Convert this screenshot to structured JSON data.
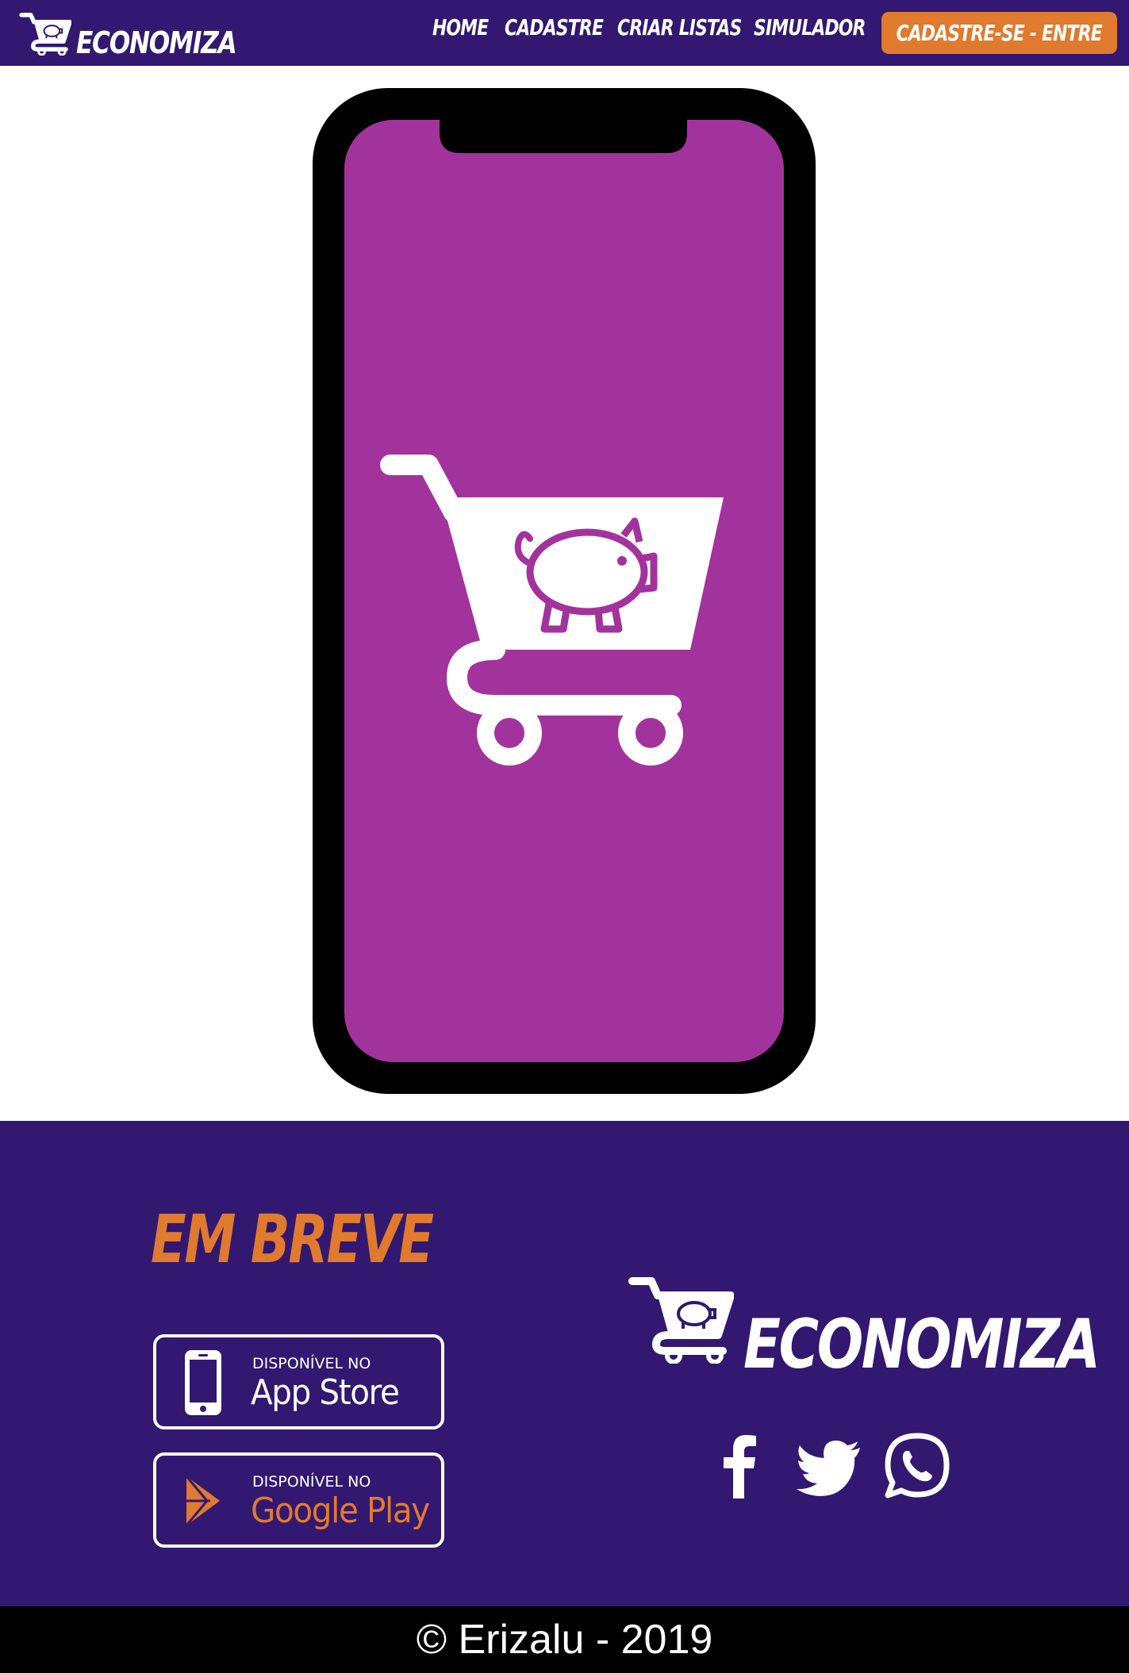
{
  "navbar": {
    "brand": "ECONOMIZA",
    "links": [
      "HOME",
      "CADASTRE",
      "CRIAR LISTAS",
      "SIMULADOR"
    ],
    "cta": "CADASTRE-SE - ENTRE"
  },
  "hero": {
    "image_icon": "shopping-cart-piggy-bank-icon"
  },
  "footer": {
    "coming_soon": "EM BREVE",
    "app_store": {
      "small": "DISPONÍVEL NO",
      "big": "App Store"
    },
    "google_play": {
      "small": "DISPONÍVEL NO",
      "big": "Google Play"
    },
    "brand": "ECONOMIZA",
    "social": [
      "facebook-icon",
      "twitter-icon",
      "whatsapp-icon"
    ]
  },
  "copyright": "© Erizalu - 2019",
  "colors": {
    "primary": "#321870",
    "accent": "#e07a2e",
    "screen": "#a3339c"
  }
}
